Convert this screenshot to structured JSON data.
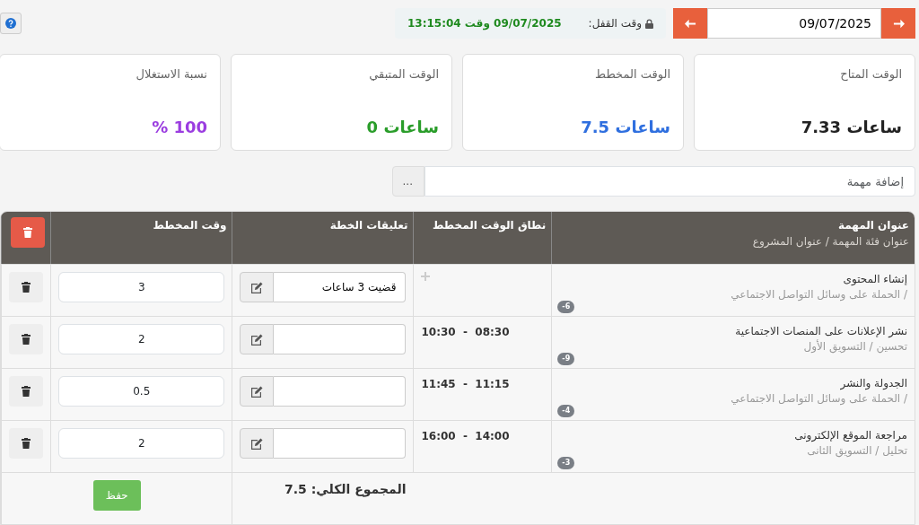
{
  "date_nav": {
    "date": "09/07/2025"
  },
  "lock": {
    "label": "وقت القفل:",
    "value": "09/07/2025 وقت 13:15:04"
  },
  "stats": [
    {
      "label": "الوقت المتاح",
      "value": "7.33 ساعات",
      "color": "#222222"
    },
    {
      "label": "الوقت المخطط",
      "value": "7.5 ساعات",
      "color": "#2f6fdf"
    },
    {
      "label": "الوقت المتبقي",
      "value": "0 ساعات",
      "color": "#2a9d2a"
    },
    {
      "label": "نسبة الاستغلال",
      "value": "% 100",
      "color": "#9b3de0"
    }
  ],
  "add_task": {
    "placeholder": "إضافة مهمة",
    "button": "..."
  },
  "table": {
    "columns": [
      {
        "title": "عنوان المهمة",
        "subtitle": "عنوان فئة المهمة  /  عنوان المشروع"
      },
      {
        "title": "نطاق الوقت المخطط"
      },
      {
        "title": "تعليقات الخطة"
      },
      {
        "title": "وقت المخطط"
      }
    ],
    "rows": [
      {
        "title": "إنشاء المحتوى",
        "subtitle": "/ الحملة على وسائل التواصل الاجتماعي",
        "badge": "-6",
        "comment": "قضيت 3 ساعات",
        "planned": "3"
      },
      {
        "title": "نشر الإعلانات على المنصات الاجتماعية",
        "subtitle": "تحسين  /  التسويق الأول",
        "badge": "-9",
        "time_range": "10:30  -  08:30",
        "planned": "2"
      },
      {
        "title": "الجدولة والنشر",
        "subtitle": "/ الحملة على وسائل التواصل الاجتماعي",
        "badge": "-4",
        "time_range": "11:45  -  11:15",
        "planned": "0.5"
      },
      {
        "title": "مراجعة الموقع الإلكترونى",
        "subtitle": "تحليل  /  التسويق الثانى",
        "badge": "-3",
        "time_range": "16:00  -  14:00",
        "planned": "2"
      }
    ],
    "total": "المجموع الكلي: 7.5",
    "save": "حفظ"
  }
}
